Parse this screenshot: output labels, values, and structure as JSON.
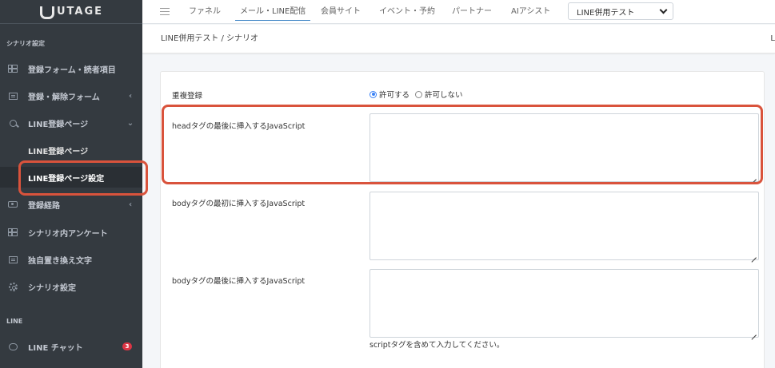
{
  "app": {
    "logo_text": "UTAGE"
  },
  "sidebar": {
    "section_scenario": "シナリオ設定",
    "section_line": "LINE",
    "items": [
      {
        "label": "登録フォーム・読者項目",
        "icon": "table-icon"
      },
      {
        "label": "登録・解除フォーム",
        "icon": "form-icon",
        "chevron": "‹"
      },
      {
        "label": "LINE登録ページ",
        "icon": "search-icon",
        "chevron": "⌄"
      },
      {
        "label": "登録経路",
        "icon": "route-icon",
        "chevron": "‹"
      },
      {
        "label": "シナリオ内アンケート",
        "icon": "table-icon"
      },
      {
        "label": "独自置き換え文字",
        "icon": "form-icon"
      },
      {
        "label": "シナリオ設定",
        "icon": "gear-icon"
      },
      {
        "label": "LINE チャット",
        "icon": "chat-icon",
        "badge": "3"
      }
    ],
    "subitems": [
      {
        "label": "LINE登録ページ",
        "active": false
      },
      {
        "label": "LINE登録ページ設定",
        "active": true
      }
    ]
  },
  "topnav": {
    "links": [
      "ファネル",
      "メール・LINE配信",
      "会員サイト",
      "イベント・予約",
      "パートナー",
      "AIアシスト"
    ],
    "active_index": 1,
    "project_select": "LINE併用テスト"
  },
  "breadcrumb": {
    "path": "LINE併用テスト / シナリオ",
    "right_fragment": "L"
  },
  "form": {
    "duplicate_label": "重複登録",
    "duplicate_options": [
      "許可する",
      "許可しない"
    ],
    "duplicate_selected": "許可する",
    "fields": [
      {
        "label": "headタグの最後に挿入するJavaScript",
        "value": ""
      },
      {
        "label": "bodyタグの最初に挿入するJavaScript",
        "value": ""
      },
      {
        "label": "bodyタグの最後に挿入するJavaScript",
        "value": ""
      }
    ],
    "help_text": "scriptタグを含めて入力してください。"
  },
  "colors": {
    "sidebar_bg": "#343a40",
    "accent": "#3b82c4",
    "highlight": "#d9533c",
    "badge": "#dc3545"
  }
}
